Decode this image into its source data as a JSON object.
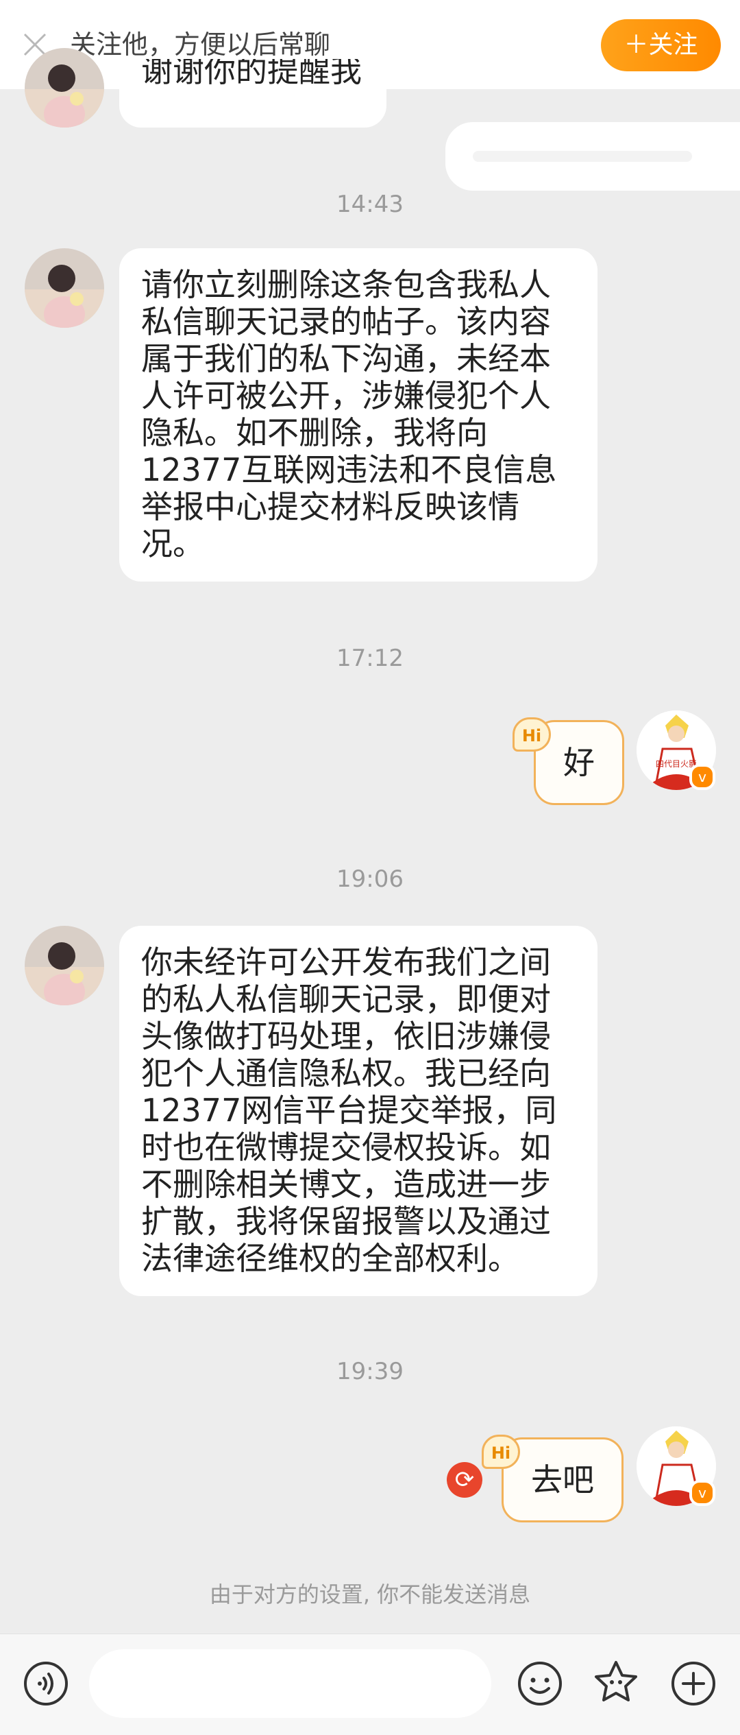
{
  "banner": {
    "text": "关注他，方便以后常聊",
    "follow_label": "＋关注"
  },
  "messages": [
    {
      "from": "other",
      "text": "谢谢你的提醒我"
    },
    {
      "from": "self",
      "text": ""
    },
    {
      "time": "14:43"
    },
    {
      "from": "other",
      "text": "请你立刻删除这条包含我私人私信聊天记录的帖子。该内容属于我们的私下沟通，未经本人许可被公开，涉嫌侵犯个人隐私。如不删除，我将向12377互联网违法和不良信息举报中心提交材料反映该情况。"
    },
    {
      "time": "17:12"
    },
    {
      "from": "self",
      "text": "好",
      "badge": "Hi"
    },
    {
      "time": "19:06"
    },
    {
      "from": "other",
      "text": "你未经许可公开发布我们之间的私人私信聊天记录，即便对头像做打码处理，依旧涉嫌侵犯个人通信隐私权。我已经向12377网信平台提交举报，同时也在微博提交侵权投诉。如不删除相关博文，造成进一步扩散，我将保留报警以及通过法律途径维权的全部权利。"
    },
    {
      "time": "19:39"
    },
    {
      "from": "self",
      "text": "去吧",
      "badge": "Hi",
      "failed": true
    }
  ],
  "self_avatar_text": "四代目火影",
  "verified_mark": "v",
  "notice": "由于对方的设置, 你不能发送消息",
  "colors": {
    "accent": "#ff8a00",
    "bubble_border": "#f2b25a",
    "error": "#e8452c",
    "background": "#ededed"
  },
  "icons": [
    "close-icon",
    "voice-icon",
    "emoji-icon",
    "sticker-icon",
    "plus-icon",
    "resend-icon",
    "verified-icon"
  ]
}
